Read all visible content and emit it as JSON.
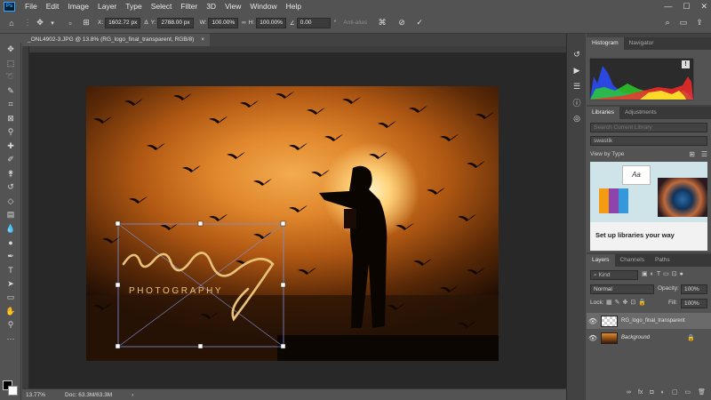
{
  "app": {
    "logo": "Ps"
  },
  "menu": [
    "File",
    "Edit",
    "Image",
    "Layer",
    "Type",
    "Select",
    "Filter",
    "3D",
    "View",
    "Window",
    "Help"
  ],
  "window_controls": {
    "minimize": "—",
    "maximize": "☐",
    "close": "✕"
  },
  "options": {
    "x_label": "X:",
    "x_value": "1602.72 px",
    "y_label": "Y:",
    "y_value": "2788.00 px",
    "w_label": "W:",
    "w_value": "100.00%",
    "h_label": "H:",
    "h_value": "100.00%",
    "angle_value": "0.00",
    "angle_unit": "°",
    "antialias_label": "Anti-alias"
  },
  "document": {
    "tab_title": "_ONL4902-3.JPG @ 13.8% (RG_logo_final_transparent, RGB/8)",
    "tab_close": "×",
    "overlay_logo_text": "rg",
    "overlay_subtitle": "PHOTOGRAPHY"
  },
  "status": {
    "zoom": "13.77%",
    "doc_info": "Doc: 63.3M/63.3M",
    "arrow": "›"
  },
  "panels": {
    "histogram_tabs": [
      "Histogram",
      "Navigator"
    ],
    "warning": "!",
    "libraries_tabs": [
      "Libraries",
      "Adjustments"
    ],
    "search_placeholder": "Search Current Library",
    "library_name": "swastik",
    "view_by": "View by Type",
    "promo_text": "Set up libraries your way",
    "layers_tabs": [
      "Layers",
      "Channels",
      "Paths"
    ],
    "kind_label": "Kind",
    "blend_mode": "Normal",
    "opacity_label": "Opacity:",
    "opacity_value": "100%",
    "lock_label": "Lock:",
    "fill_label": "Fill:",
    "fill_value": "100%",
    "layers": [
      {
        "name": "RG_logo_final_transparent",
        "selected": true
      },
      {
        "name": "Background",
        "selected": false
      }
    ],
    "footer_icons": [
      "∞",
      "fx",
      "◘",
      "◐",
      "▢",
      "▭",
      "🗑"
    ]
  },
  "colors": {
    "accent": "#31a8ff",
    "ui_bg": "#535353",
    "canvas_bg": "#282828"
  }
}
